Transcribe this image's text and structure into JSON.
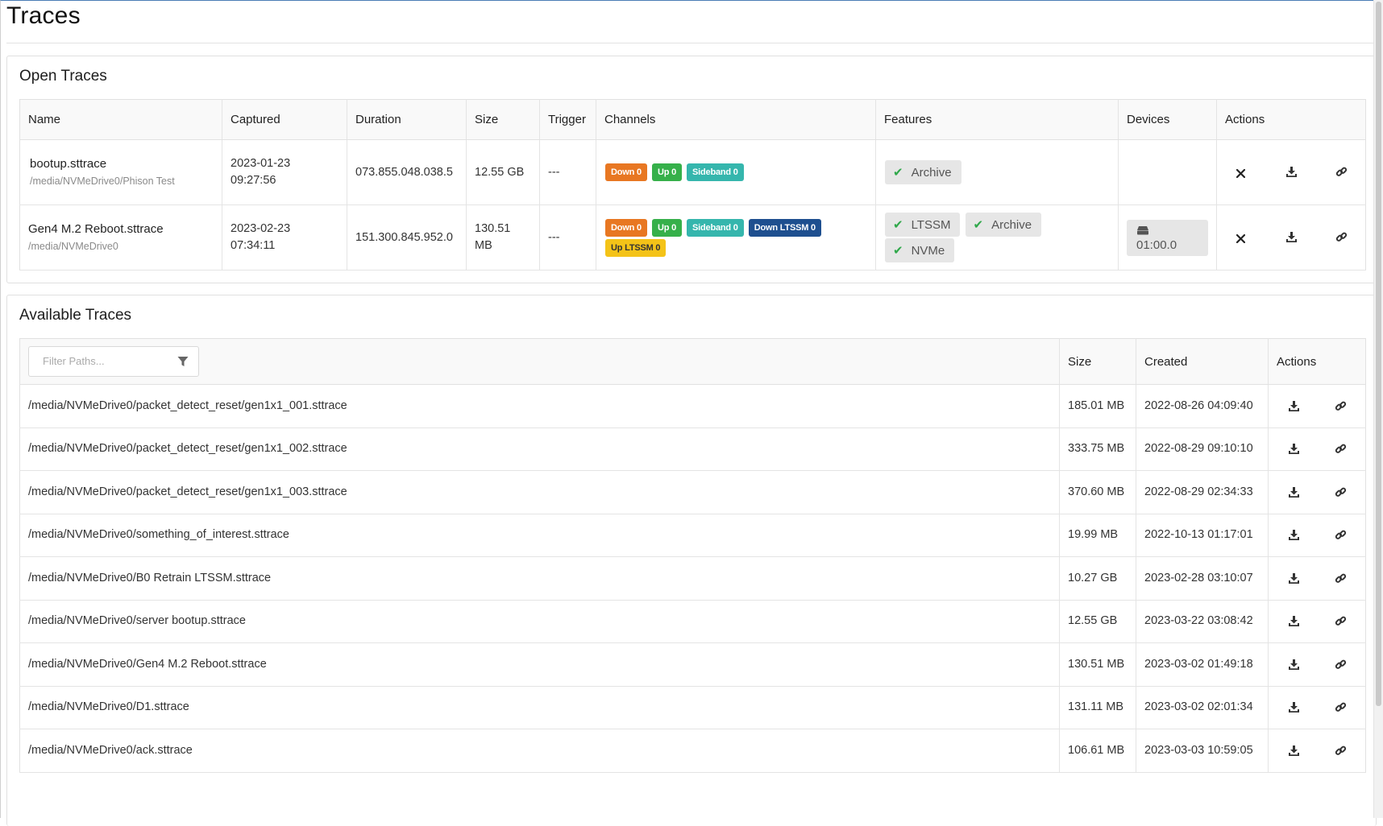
{
  "page": {
    "title": "Traces"
  },
  "open_traces": {
    "title": "Open Traces",
    "columns": {
      "name": "Name",
      "captured": "Captured",
      "duration": "Duration",
      "size": "Size",
      "trigger": "Trigger",
      "channels": "Channels",
      "features": "Features",
      "devices": "Devices",
      "actions": "Actions"
    },
    "rows": [
      {
        "name": "bootup.sttrace",
        "path": "/media/NVMeDrive0/Phison Test",
        "captured_date": "2023-01-23",
        "captured_time": "09:27:56",
        "duration": "073.855.048.038.5",
        "size": "12.55 GB",
        "trigger": "---",
        "channels": [
          "Down 0",
          "Up 0",
          "Sideband 0"
        ],
        "features": [
          "Archive"
        ],
        "device": ""
      },
      {
        "name": "Gen4 M.2 Reboot.sttrace",
        "path": "/media/NVMeDrive0",
        "captured_date": "2023-02-23",
        "captured_time": "07:34:11",
        "duration": "151.300.845.952.0",
        "size": "130.51 MB",
        "trigger": "---",
        "channels": [
          "Down 0",
          "Up 0",
          "Sideband 0",
          "Down LTSSM 0",
          "Up LTSSM 0"
        ],
        "features": [
          "LTSSM",
          "Archive",
          "NVMe"
        ],
        "device": "01:00.0"
      }
    ],
    "channel_colors": {
      "down": "#e87722",
      "up": "#36b04a",
      "sideband": "#35b6ad",
      "down_ltssm": "#1e4f8f",
      "up_ltssm": "#f4c318"
    }
  },
  "available_traces": {
    "title": "Available Traces",
    "filter_placeholder": "Filter Paths...",
    "columns": {
      "size": "Size",
      "created": "Created",
      "actions": "Actions"
    },
    "rows": [
      {
        "path": "/media/NVMeDrive0/packet_detect_reset/gen1x1_001.sttrace",
        "size": "185.01 MB",
        "created": "2022-08-26 04:09:40"
      },
      {
        "path": "/media/NVMeDrive0/packet_detect_reset/gen1x1_002.sttrace",
        "size": "333.75 MB",
        "created": "2022-08-29 09:10:10"
      },
      {
        "path": "/media/NVMeDrive0/packet_detect_reset/gen1x1_003.sttrace",
        "size": "370.60 MB",
        "created": "2022-08-29 02:34:33"
      },
      {
        "path": "/media/NVMeDrive0/something_of_interest.sttrace",
        "size": "19.99 MB",
        "created": "2022-10-13 01:17:01"
      },
      {
        "path": "/media/NVMeDrive0/B0 Retrain LTSSM.sttrace",
        "size": "10.27 GB",
        "created": "2023-02-28 03:10:07"
      },
      {
        "path": "/media/NVMeDrive0/server bootup.sttrace",
        "size": "12.55 GB",
        "created": "2023-03-22 03:08:42"
      },
      {
        "path": "/media/NVMeDrive0/Gen4 M.2 Reboot.sttrace",
        "size": "130.51 MB",
        "created": "2023-03-02 01:49:18"
      },
      {
        "path": "/media/NVMeDrive0/D1.sttrace",
        "size": "131.11 MB",
        "created": "2023-03-02 02:01:34"
      },
      {
        "path": "/media/NVMeDrive0/ack.sttrace",
        "size": "106.61 MB",
        "created": "2023-03-03 10:59:05"
      }
    ]
  },
  "icons": {
    "close": "close-icon",
    "download": "download-icon",
    "link": "link-icon",
    "filter": "filter-icon",
    "check": "check-icon",
    "device": "drive-icon"
  }
}
